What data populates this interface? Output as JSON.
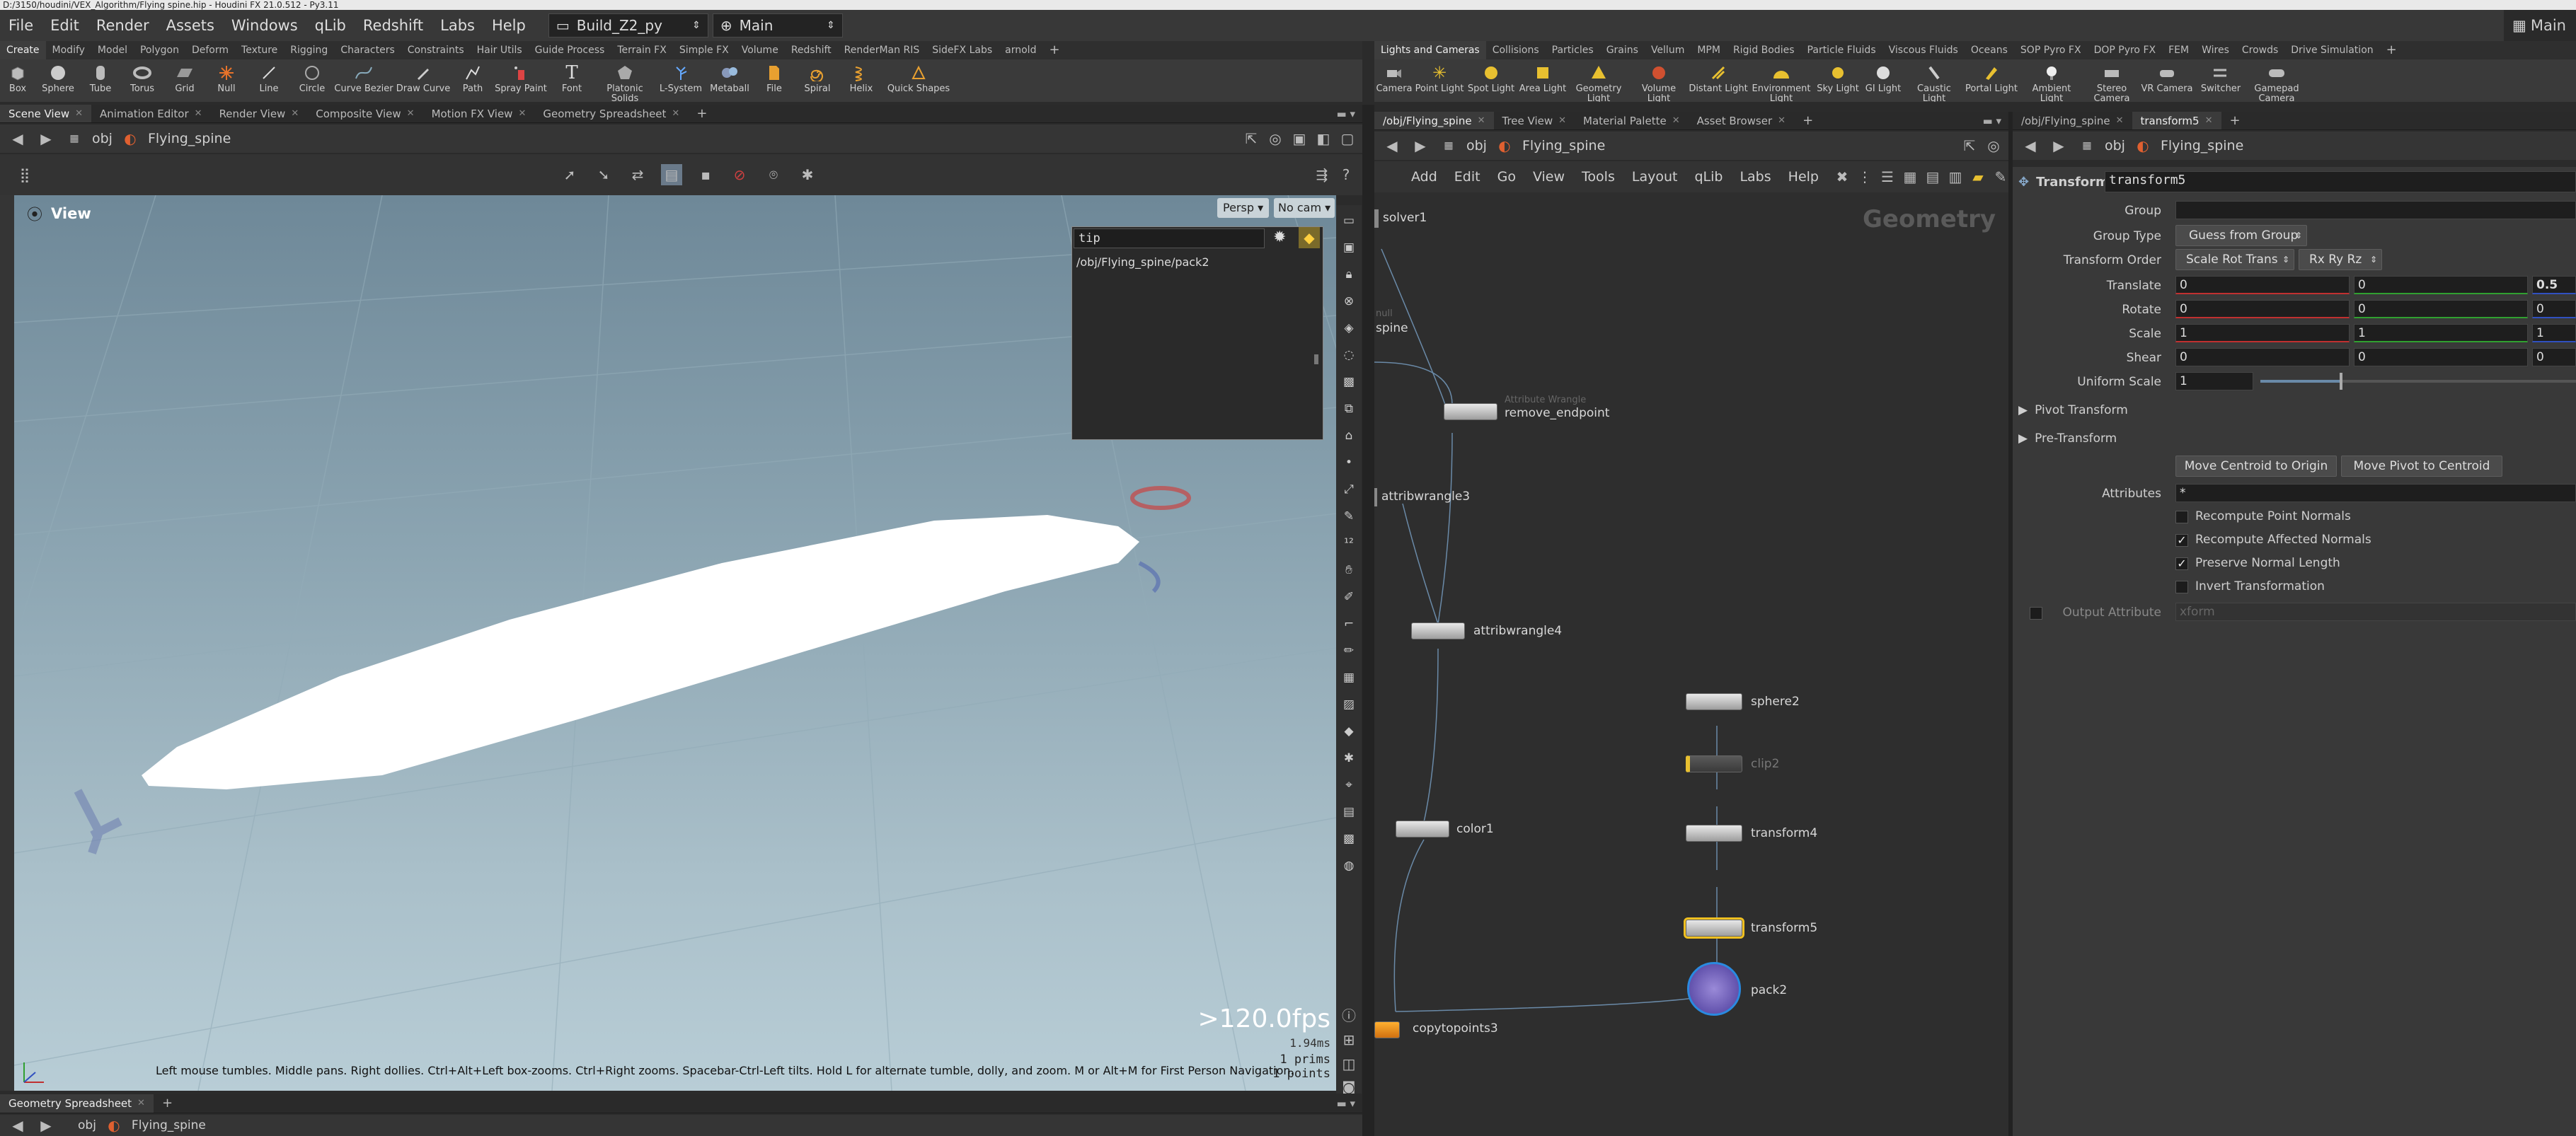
{
  "titlebar": {
    "text": "D:/3150/houdini/VEX_Algorithm/Flying spine.hip - Houdini FX 21.0.512 - Py3.11"
  },
  "menubar": {
    "items": [
      "File",
      "Edit",
      "Render",
      "Assets",
      "Windows",
      "qLib",
      "Redshift",
      "Labs",
      "Help"
    ],
    "desktop": "Build_Z2_py",
    "context": "Main",
    "right_label": "Main"
  },
  "shelf_left": {
    "tabs": [
      "Create",
      "Modify",
      "Model",
      "Polygon",
      "Deform",
      "Texture",
      "Rigging",
      "Characters",
      "Constraints",
      "Hair Utils",
      "Guide Process",
      "Terrain FX",
      "Simple FX",
      "Volume",
      "Redshift",
      "RenderMan RIS",
      "SideFX Labs",
      "arnold"
    ],
    "tools": [
      "Box",
      "Sphere",
      "Tube",
      "Torus",
      "Grid",
      "Null",
      "Line",
      "Circle",
      "Curve Bezier",
      "Draw Curve",
      "Path",
      "Spray Paint",
      "Font",
      "Platonic Solids",
      "L-System",
      "Metaball",
      "File",
      "Spiral",
      "Helix",
      "Quick Shapes"
    ]
  },
  "shelf_right": {
    "tabs": [
      "Lights and Cameras",
      "Collisions",
      "Particles",
      "Grains",
      "Vellum",
      "MPM",
      "Rigid Bodies",
      "Particle Fluids",
      "Viscous Fluids",
      "Oceans",
      "SOP Pyro FX",
      "DOP Pyro FX",
      "FEM",
      "Wires",
      "Crowds",
      "Drive Simulation"
    ],
    "tools": [
      "Camera",
      "Point Light",
      "Spot Light",
      "Area Light",
      "Geometry Light",
      "Volume Light",
      "Distant Light",
      "Environment Light",
      "Sky Light",
      "GI Light",
      "Caustic Light",
      "Portal Light",
      "Ambient Light",
      "Stereo Camera",
      "VR Camera",
      "Switcher",
      "Gamepad Camera"
    ]
  },
  "scene_pane": {
    "tabs": [
      "Scene View",
      "Animation Editor",
      "Render View",
      "Composite View",
      "Motion FX View",
      "Geometry Spreadsheet"
    ],
    "path": [
      "obj",
      "Flying_spine"
    ],
    "view_label": "View",
    "persp": "Persp",
    "cam": "No cam",
    "search_value": "tip",
    "search_result": "/obj/Flying_spine/pack2",
    "fps": ">120.0fps",
    "time": "1.94ms",
    "prims": "1  prims",
    "points": "1  points",
    "status": "Left mouse tumbles. Middle pans. Right dollies. Ctrl+Alt+Left box-zooms. Ctrl+Right zooms. Spacebar-Ctrl-Left tilts. Hold L for alternate tumble, dolly, and zoom. M or Alt+M for First Person Navigation."
  },
  "bottom_pane": {
    "tab": "Geometry Spreadsheet",
    "path": [
      "obj",
      "Flying_spine"
    ]
  },
  "network_pane": {
    "tabs": [
      "/obj/Flying_spine",
      "Tree View",
      "Material Palette",
      "Asset Browser"
    ],
    "path": [
      "obj",
      "Flying_spine"
    ],
    "menu": [
      "Add",
      "Edit",
      "Go",
      "View",
      "Tools",
      "Layout",
      "qLib",
      "Labs",
      "Help"
    ],
    "context_label": "Geometry",
    "nodes": {
      "solver1": "solver1",
      "spine_sub": "null",
      "spine": "spine",
      "remove_sub": "Attribute Wrangle",
      "remove_endpoint": "remove_endpoint",
      "attribwrangle3": "attribwrangle3",
      "attribwrangle4": "attribwrangle4",
      "color1": "color1",
      "copytopoints3": "copytopoints3",
      "sphere2": "sphere2",
      "clip2": "clip2",
      "transform4": "transform4",
      "transform5": "transform5",
      "pack2": "pack2"
    }
  },
  "param_pane": {
    "tabs": [
      "/obj/Flying_spine",
      "transform5"
    ],
    "path": [
      "obj",
      "Flying_spine"
    ],
    "node_type": "Transform",
    "node_name": "transform5",
    "labels": {
      "group": "Group",
      "group_type": "Group Type",
      "transform_order": "Transform Order",
      "translate": "Translate",
      "rotate": "Rotate",
      "scale": "Scale",
      "shear": "Shear",
      "uniform_scale": "Uniform Scale",
      "pivot": "Pivot Transform",
      "pre": "Pre-Transform",
      "attributes": "Attributes",
      "output_attr": "Output Attribute"
    },
    "group_type": "Guess from Group",
    "trs_order": "Scale Rot Trans",
    "rot_order": "Rx Ry Rz",
    "translate": [
      "0",
      "0",
      "0.5"
    ],
    "rotate": [
      "0",
      "0",
      "0"
    ],
    "scale": [
      "1",
      "1",
      "1"
    ],
    "shear": [
      "0",
      "0",
      "0"
    ],
    "uniform_scale": "1",
    "uniform_scale_fraction": 0.25,
    "move_centroid": "Move Centroid to Origin",
    "move_pivot": "Move Pivot to Centroid",
    "attributes": "*",
    "checks": {
      "recompute_point": "Recompute Point Normals",
      "recompute_affected": "Recompute Affected Normals",
      "preserve": "Preserve Normal Length",
      "invert": "Invert Transformation"
    },
    "output_attr_placeholder": "xform"
  }
}
